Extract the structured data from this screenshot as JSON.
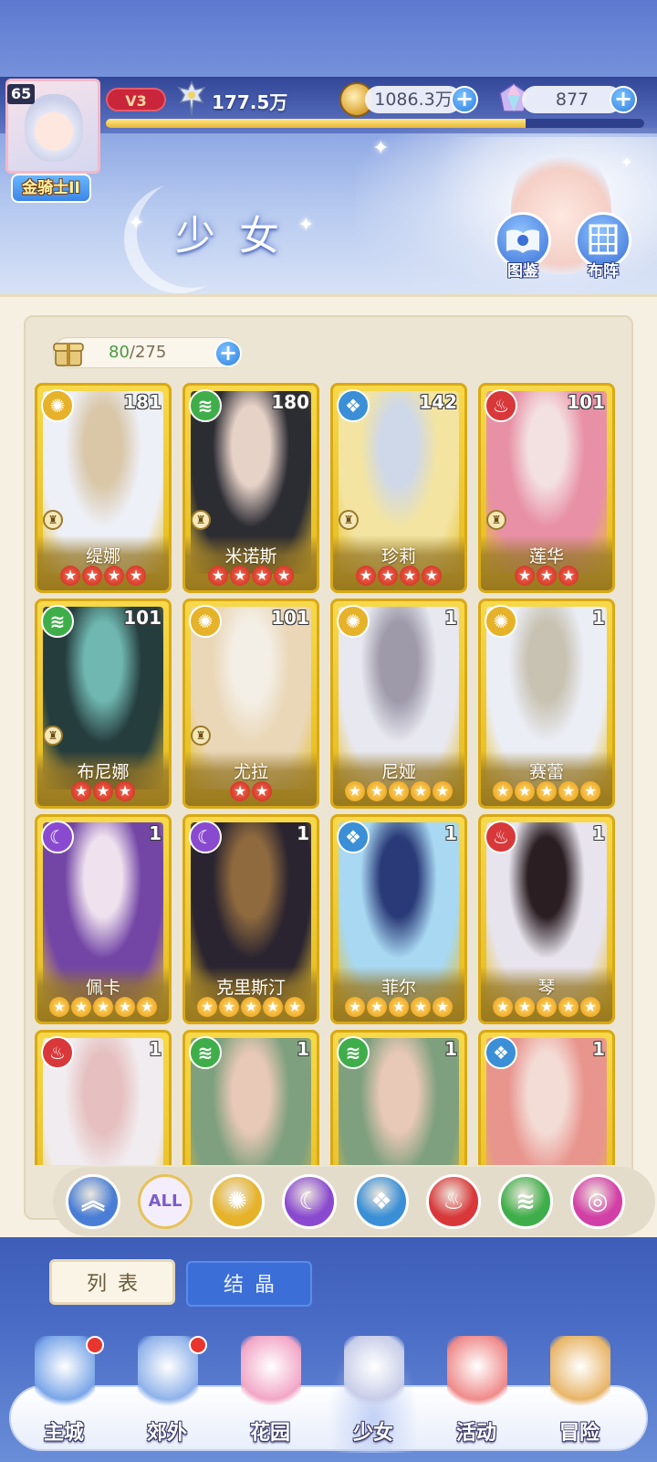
{
  "header": {
    "player_level": "65",
    "rank_title": "金骑士II",
    "vip": "V3",
    "power": "177.5万",
    "coins": "1086.3万",
    "gems": "877",
    "exp_progress": 0.78,
    "page_title": "少女",
    "buttons": {
      "collection": "图鉴",
      "formation": "布阵"
    }
  },
  "capacity": {
    "current": "80",
    "max": "/275"
  },
  "cards": [
    {
      "name": "缇娜",
      "level": "181",
      "element": "light",
      "stars": 4,
      "star_color": "red",
      "art": [
        "#eef0f8",
        "#d9c7a8"
      ]
    },
    {
      "name": "米诺斯",
      "level": "180",
      "element": "wind",
      "stars": 4,
      "star_color": "red",
      "art": [
        "#2c2c33",
        "#e7d2c8"
      ]
    },
    {
      "name": "珍莉",
      "level": "142",
      "element": "water",
      "stars": 4,
      "star_color": "red",
      "art": [
        "#f3e4a2",
        "#cfd8e8"
      ]
    },
    {
      "name": "莲华",
      "level": "101",
      "element": "fire",
      "stars": 3,
      "star_color": "red",
      "art": [
        "#e890a6",
        "#f3e0e0"
      ]
    },
    {
      "name": "布尼娜",
      "level": "101",
      "element": "wind",
      "stars": 3,
      "star_color": "red",
      "art": [
        "#263d3e",
        "#6fb7b0"
      ]
    },
    {
      "name": "尤拉",
      "level": "101",
      "element": "light",
      "stars": 2,
      "star_color": "red",
      "art": [
        "#ead7b8",
        "#f4efe6"
      ]
    },
    {
      "name": "尼娅",
      "level": "1",
      "element": "light",
      "stars": 5,
      "star_color": "gold",
      "art": [
        "#e8e8f0",
        "#9e9aaa"
      ]
    },
    {
      "name": "赛蕾",
      "level": "1",
      "element": "light",
      "stars": 5,
      "star_color": "gold",
      "art": [
        "#eceef6",
        "#c8c2b2"
      ]
    },
    {
      "name": "佩卡",
      "level": "1",
      "element": "dark",
      "stars": 5,
      "star_color": "gold",
      "art": [
        "#7346a6",
        "#efe2ee"
      ]
    },
    {
      "name": "克里斯汀",
      "level": "1",
      "element": "dark",
      "stars": 5,
      "star_color": "gold",
      "art": [
        "#2a2430",
        "#8f6a3e"
      ]
    },
    {
      "name": "菲尔",
      "level": "1",
      "element": "water",
      "stars": 5,
      "star_color": "gold",
      "art": [
        "#a8d8f2",
        "#2a3a78"
      ]
    },
    {
      "name": "琴",
      "level": "1",
      "element": "fire",
      "stars": 5,
      "star_color": "gold",
      "art": [
        "#e8e4ee",
        "#2b1e22"
      ]
    },
    {
      "name": "",
      "level": "1",
      "element": "fire",
      "stars": 0,
      "star_color": "gold",
      "art": [
        "#f1ecef",
        "#e6c0c0"
      ]
    },
    {
      "name": "",
      "level": "1",
      "element": "wind",
      "stars": 0,
      "star_color": "gold",
      "art": [
        "#7fa07e",
        "#e8c8b6"
      ]
    },
    {
      "name": "",
      "level": "1",
      "element": "wind",
      "stars": 0,
      "star_color": "gold",
      "art": [
        "#7fa07e",
        "#e8c8b6"
      ]
    },
    {
      "name": "",
      "level": "1",
      "element": "water",
      "stars": 0,
      "star_color": "red",
      "art": [
        "#e8958e",
        "#f4dcd6"
      ]
    }
  ],
  "element_icons": {
    "light": {
      "glyph": "✺",
      "color": "#e6b22a"
    },
    "wind": {
      "glyph": "≋",
      "color": "#3fae4a"
    },
    "water": {
      "glyph": "❖",
      "color": "#3a8fd6"
    },
    "fire": {
      "glyph": "♨",
      "color": "#d8383a"
    },
    "dark": {
      "glyph": "☾",
      "color": "#8a4ad0"
    }
  },
  "filters": [
    {
      "id": "sort",
      "label": "︽",
      "color": "#4a7ed6"
    },
    {
      "id": "all",
      "label": "ALL",
      "color": "#7b5cc8"
    },
    {
      "id": "light",
      "label": "✺",
      "color": "#e6b22a"
    },
    {
      "id": "dark",
      "label": "☾",
      "color": "#8a4ad0"
    },
    {
      "id": "water",
      "label": "❖",
      "color": "#3a8fd6"
    },
    {
      "id": "fire",
      "label": "♨",
      "color": "#d8383a"
    },
    {
      "id": "wind",
      "label": "≋",
      "color": "#3fae4a"
    },
    {
      "id": "special",
      "label": "◎",
      "color": "#d23fa6"
    }
  ],
  "subtabs": {
    "list": "列表",
    "crystal": "结晶"
  },
  "nav": [
    {
      "id": "main-city",
      "label": "主城",
      "badge": true,
      "color": "#7aa6e8"
    },
    {
      "id": "suburb",
      "label": "郊外",
      "badge": true,
      "color": "#8fb2ea"
    },
    {
      "id": "garden",
      "label": "花园",
      "badge": false,
      "color": "#f2a6c6"
    },
    {
      "id": "girls",
      "label": "少女",
      "badge": false,
      "color": "#c8cde8",
      "active": true
    },
    {
      "id": "events",
      "label": "活动",
      "badge": false,
      "color": "#ef8a8a"
    },
    {
      "id": "adventure",
      "label": "冒险",
      "badge": false,
      "color": "#e8b568"
    }
  ]
}
